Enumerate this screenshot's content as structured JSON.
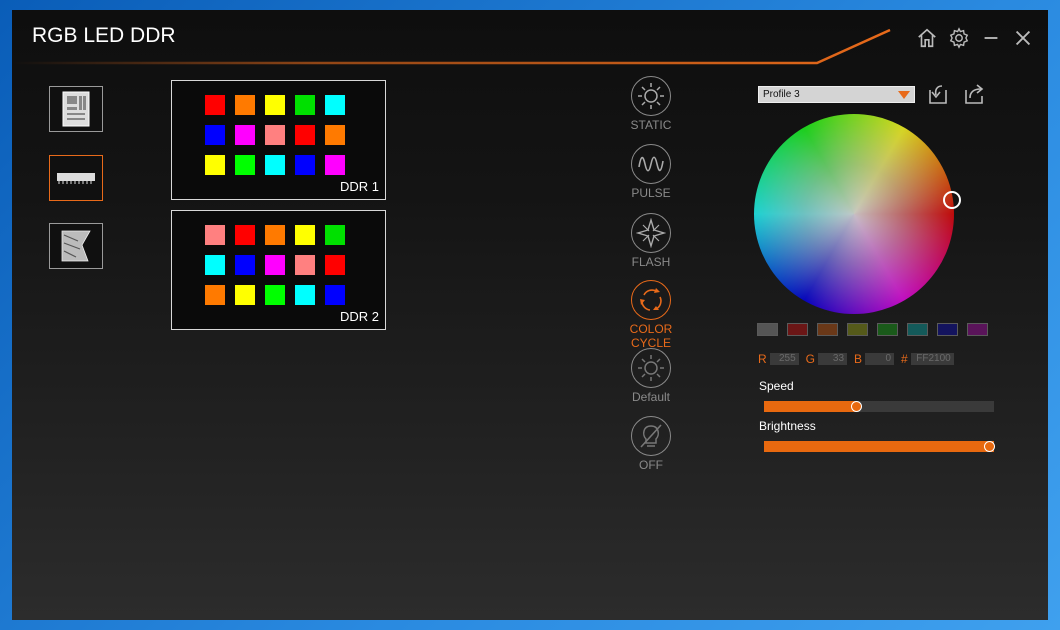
{
  "window": {
    "title": "RGB LED DDR"
  },
  "titlebar": {
    "home_icon": "home-icon",
    "settings_icon": "gear-icon",
    "minimize_icon": "minimize-icon",
    "close_icon": "close-icon"
  },
  "sidebar": {
    "items": [
      {
        "name": "motherboard-icon",
        "active": false
      },
      {
        "name": "memory-icon",
        "active": true
      },
      {
        "name": "graphics-card-icon",
        "active": false
      }
    ]
  },
  "ddr": [
    {
      "label": "DDR 1",
      "leds": [
        "#ff0000",
        "#ff7a00",
        "#ffff00",
        "#00e000",
        "#00ffff",
        "#0000ff",
        "#ff00ff",
        "#ff8080",
        "#ff0000",
        "#ff7a00",
        "#ffff00",
        "#00ff00",
        "#00ffff",
        "#0000ff",
        "#ff00ff"
      ]
    },
    {
      "label": "DDR 2",
      "leds": [
        "#ff8080",
        "#ff0000",
        "#ff7a00",
        "#ffff00",
        "#00e000",
        "#00ffff",
        "#0000ff",
        "#ff00ff",
        "#ff8080",
        "#ff0000",
        "#ff7a00",
        "#ffff00",
        "#00ff00",
        "#00ffff",
        "#0000ff"
      ]
    }
  ],
  "modes": [
    {
      "label": "STATIC",
      "icon": "sun-icon",
      "active": false
    },
    {
      "label": "PULSE",
      "icon": "wave-icon",
      "active": false
    },
    {
      "label": "FLASH",
      "icon": "star-burst-icon",
      "active": false
    },
    {
      "label": "COLOR\nCYCLE",
      "icon": "cycle-arrows-icon",
      "active": true
    },
    {
      "label": "Default",
      "icon": "sun-icon",
      "active": false
    },
    {
      "label": "OFF",
      "icon": "bulb-off-icon",
      "active": false
    }
  ],
  "profile": {
    "selected": "Profile 3"
  },
  "colors": {
    "accent": "#e86a1a"
  },
  "presets": [
    "#555555",
    "#6b1616",
    "#6a3818",
    "#555a1a",
    "#1a5a1a",
    "#145a5a",
    "#14145e",
    "#5a145a"
  ],
  "rgb": {
    "r_label": "R",
    "r": "255",
    "g_label": "G",
    "g": "33",
    "b_label": "B",
    "b": "0",
    "hex_label": "#",
    "hex": "FF2100"
  },
  "speed": {
    "label": "Speed",
    "value": 0.4
  },
  "brightness": {
    "label": "Brightness",
    "value": 1.0
  }
}
